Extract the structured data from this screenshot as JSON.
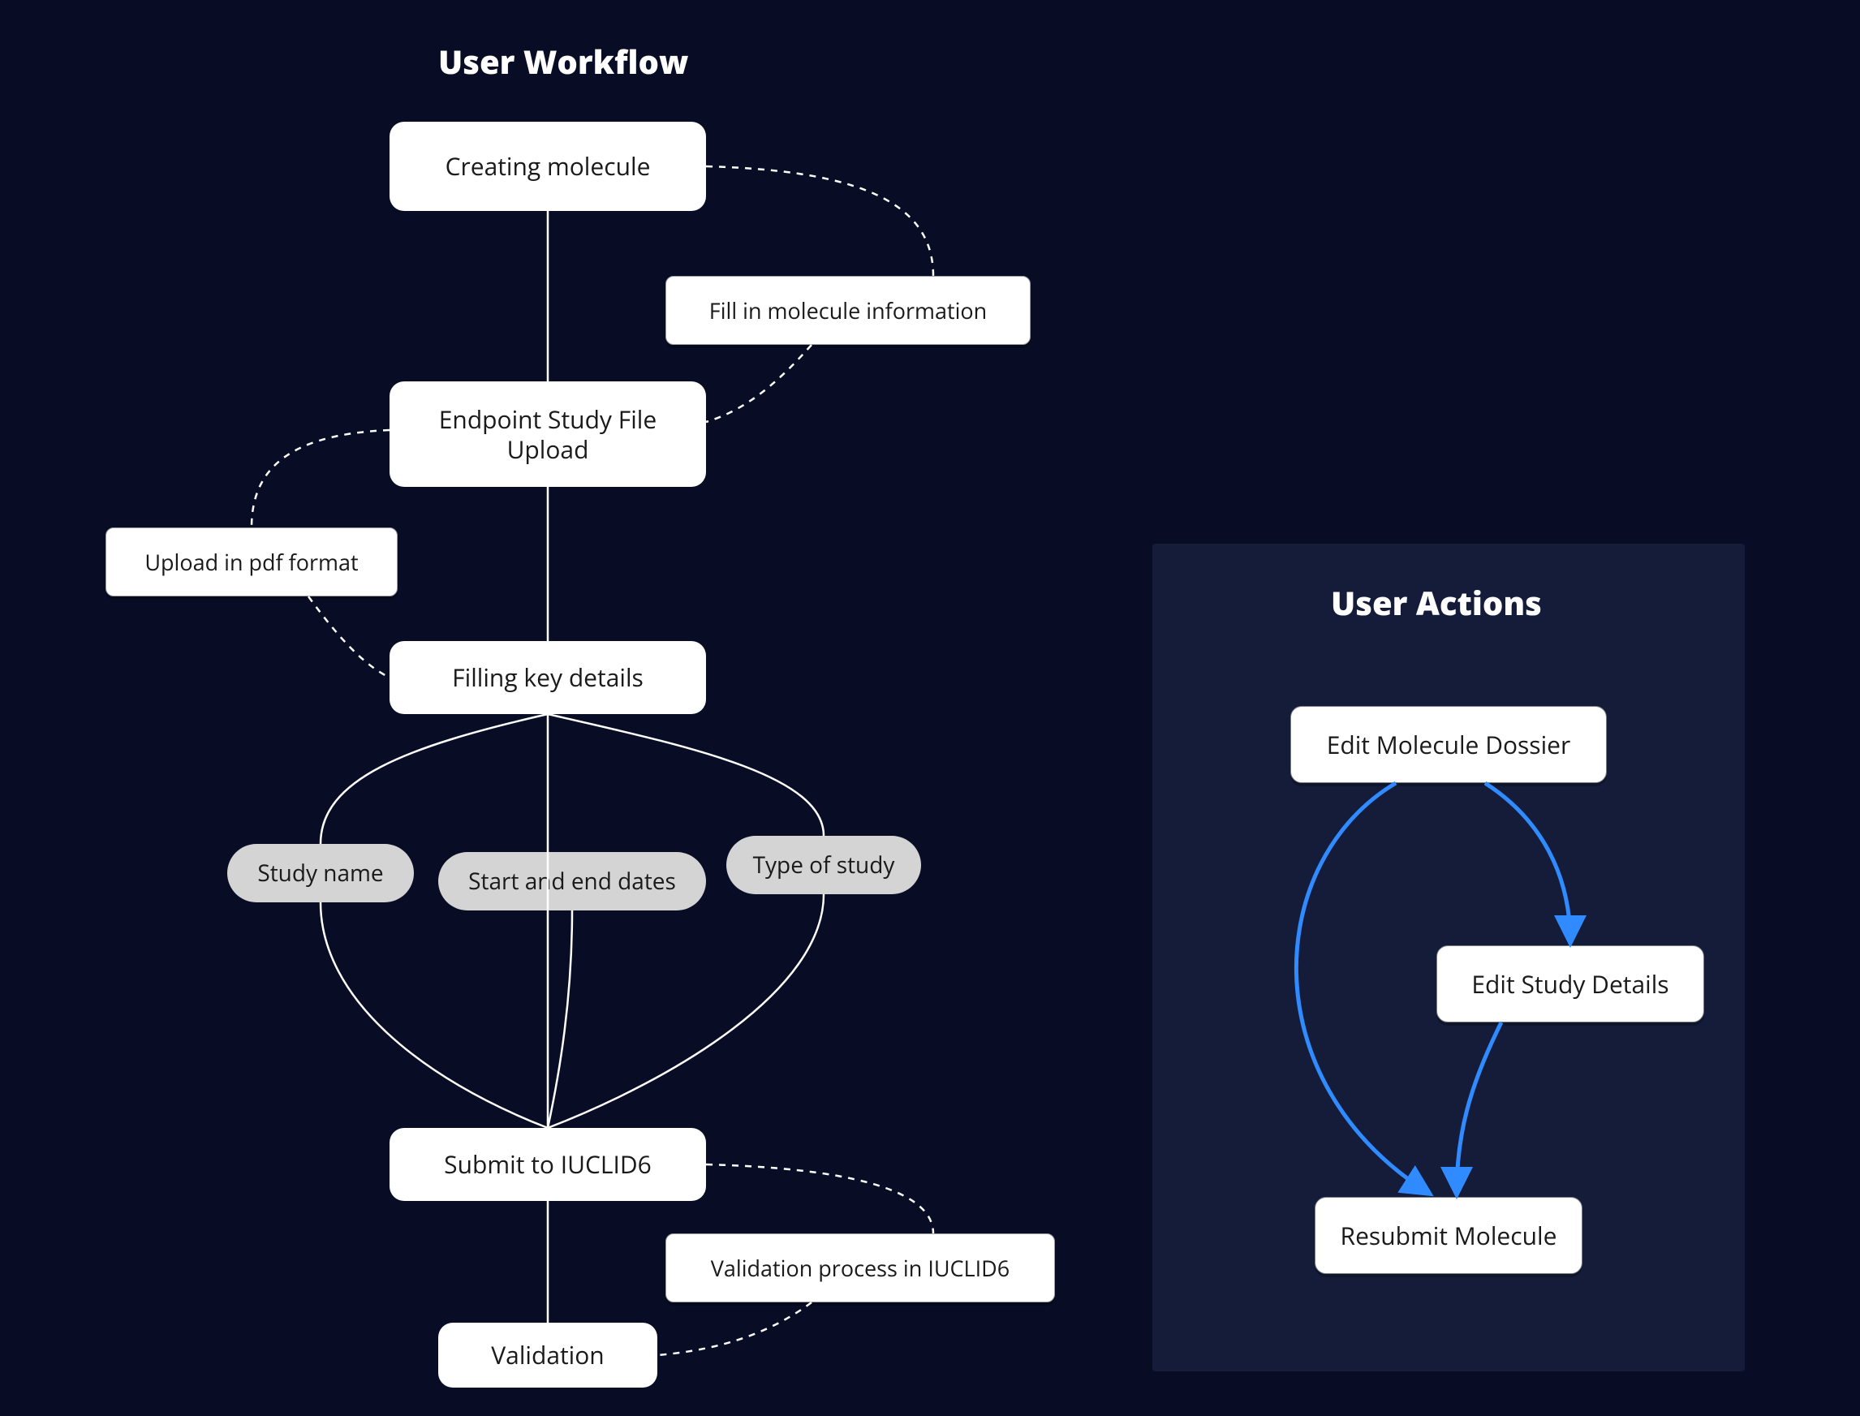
{
  "workflow": {
    "title": "User Workflow",
    "nodes": {
      "create": "Creating molecule",
      "upload": "Endpoint Study File Upload",
      "fill": "Filling key details",
      "submit": "Submit to IUCLID6",
      "validate": "Validation"
    },
    "notes": {
      "fill_info": "Fill in molecule information",
      "upload_pdf": "Upload in pdf format",
      "validation": "Validation process in IUCLID6"
    },
    "details": {
      "study_name": "Study name",
      "dates": "Start and end dates",
      "type": "Type of study"
    }
  },
  "actions": {
    "title": "User Actions",
    "nodes": {
      "edit_dossier": "Edit Molecule Dossier",
      "edit_study": "Edit Study Details",
      "resubmit": "Resubmit Molecule"
    }
  }
}
